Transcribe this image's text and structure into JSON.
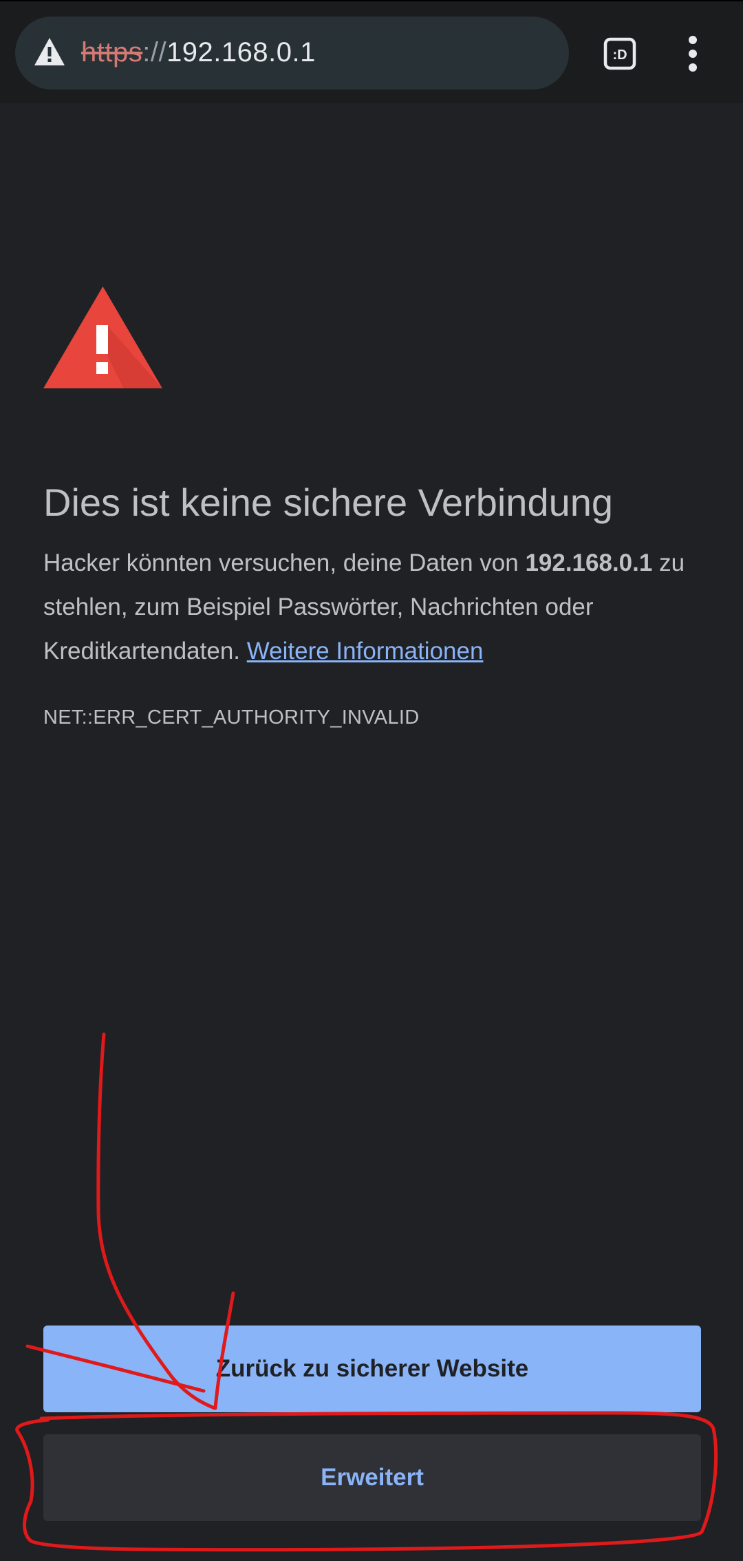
{
  "toolbar": {
    "url_scheme": "https",
    "url_separator": "://",
    "url_host": "192.168.0.1",
    "tab_switcher_label": ":D",
    "security_icon": "warning-triangle-icon",
    "menu_icon": "more-vert-icon"
  },
  "interstitial": {
    "alert_icon": "red-warning-triangle-icon",
    "heading": "Dies ist keine sichere Verbindung",
    "body_prefix": "Hacker könnten versuchen, deine Daten von ",
    "body_host": "192.168.0.1",
    "body_suffix": " zu stehlen, zum Beispiel Passwörter, Nachrichten oder Kreditkartendaten. ",
    "learn_more_link": "Weitere Informationen",
    "error_code": "NET::ERR_CERT_AUTHORITY_INVALID"
  },
  "buttons": {
    "back_to_safety": "Zurück zu sicherer Website",
    "advanced": "Erweitert"
  },
  "colors": {
    "background": "#202124",
    "toolbar": "#1b1c1e",
    "omnibox": "#283135",
    "alert_red": "#e8453c",
    "link_blue": "#8ab4f8",
    "annotation_red": "#e0191b"
  }
}
